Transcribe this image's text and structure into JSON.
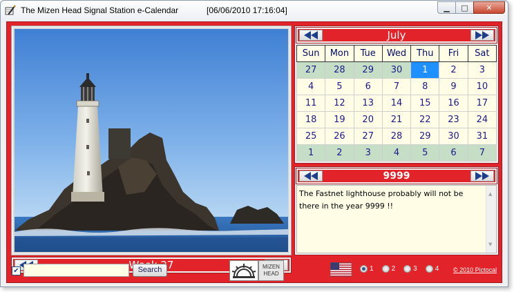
{
  "window": {
    "title": "The Mizen Head Signal Station e-Calendar",
    "datetime": "[06/06/2010 17:16:04]",
    "minimize_glyph": "▁",
    "maximize_glyph": "□",
    "close_glyph": "✕"
  },
  "photo": {
    "week_label": "Week 27",
    "prev_icon": "double-left-arrow-icon",
    "next_icon": "double-right-arrow-icon"
  },
  "calendar": {
    "month": "July",
    "weekdays": [
      "Sun",
      "Mon",
      "Tue",
      "Wed",
      "Thu",
      "Fri",
      "Sat"
    ],
    "weeks": [
      [
        "27",
        "28",
        "29",
        "30",
        "1",
        "2",
        "3"
      ],
      [
        "4",
        "5",
        "6",
        "7",
        "8",
        "9",
        "10"
      ],
      [
        "11",
        "12",
        "13",
        "14",
        "15",
        "16",
        "17"
      ],
      [
        "18",
        "19",
        "20",
        "21",
        "22",
        "23",
        "24"
      ],
      [
        "25",
        "26",
        "27",
        "28",
        "29",
        "30",
        "31"
      ],
      [
        "1",
        "2",
        "3",
        "4",
        "5",
        "6",
        "7"
      ]
    ],
    "selected_day": "1",
    "colors": {
      "other_month": "#c6dec6",
      "current_month": "#fffde6",
      "selected": "#1e90ff"
    }
  },
  "year_panel": {
    "year": "9999",
    "note": "The Fastnet lighthouse probably will not be there in the year 9999 !!"
  },
  "bottom": {
    "search_checked": true,
    "search_placeholder": "",
    "search_value": "",
    "search_button": "Search",
    "logo_label": "MIZEN HEAD",
    "radios": [
      "1",
      "2",
      "3",
      "4"
    ],
    "selected_radio": "1",
    "copyright": "© 2010 Pictocal"
  },
  "colors": {
    "accent": "#e3232a",
    "text_dark": "#1c1a8a"
  }
}
